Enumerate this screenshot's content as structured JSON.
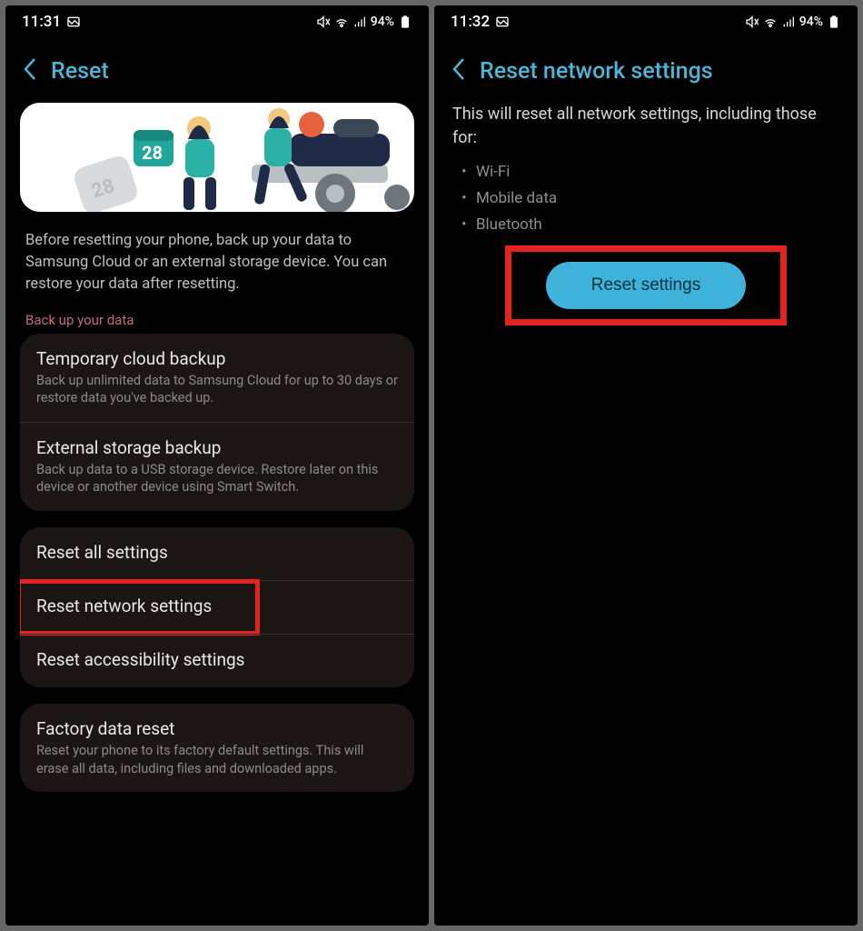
{
  "left": {
    "status": {
      "time": "11:31",
      "battery": "94%"
    },
    "title": "Reset",
    "banner_num": "28",
    "intro": "Before resetting your phone, back up your data to Samsung Cloud or an external storage device. You can restore your data after resetting.",
    "section_label": "Back up your data",
    "backup": [
      {
        "title": "Temporary cloud backup",
        "sub": "Back up unlimited data to Samsung Cloud for up to 30 days or restore data you've backed up."
      },
      {
        "title": "External storage backup",
        "sub": "Back up data to a USB storage device. Restore later on this device or another device using Smart Switch."
      }
    ],
    "reset_items": [
      {
        "title": "Reset all settings"
      },
      {
        "title": "Reset network settings"
      },
      {
        "title": "Reset accessibility settings"
      }
    ],
    "factory": {
      "title": "Factory data reset",
      "sub": "Reset your phone to its factory default settings. This will erase all data, including files and downloaded apps."
    }
  },
  "right": {
    "status": {
      "time": "11:32",
      "battery": "94%"
    },
    "title": "Reset network settings",
    "desc": "This will reset all network settings, including those for:",
    "bullets": [
      "Wi-Fi",
      "Mobile data",
      "Bluetooth"
    ],
    "action": "Reset settings"
  }
}
